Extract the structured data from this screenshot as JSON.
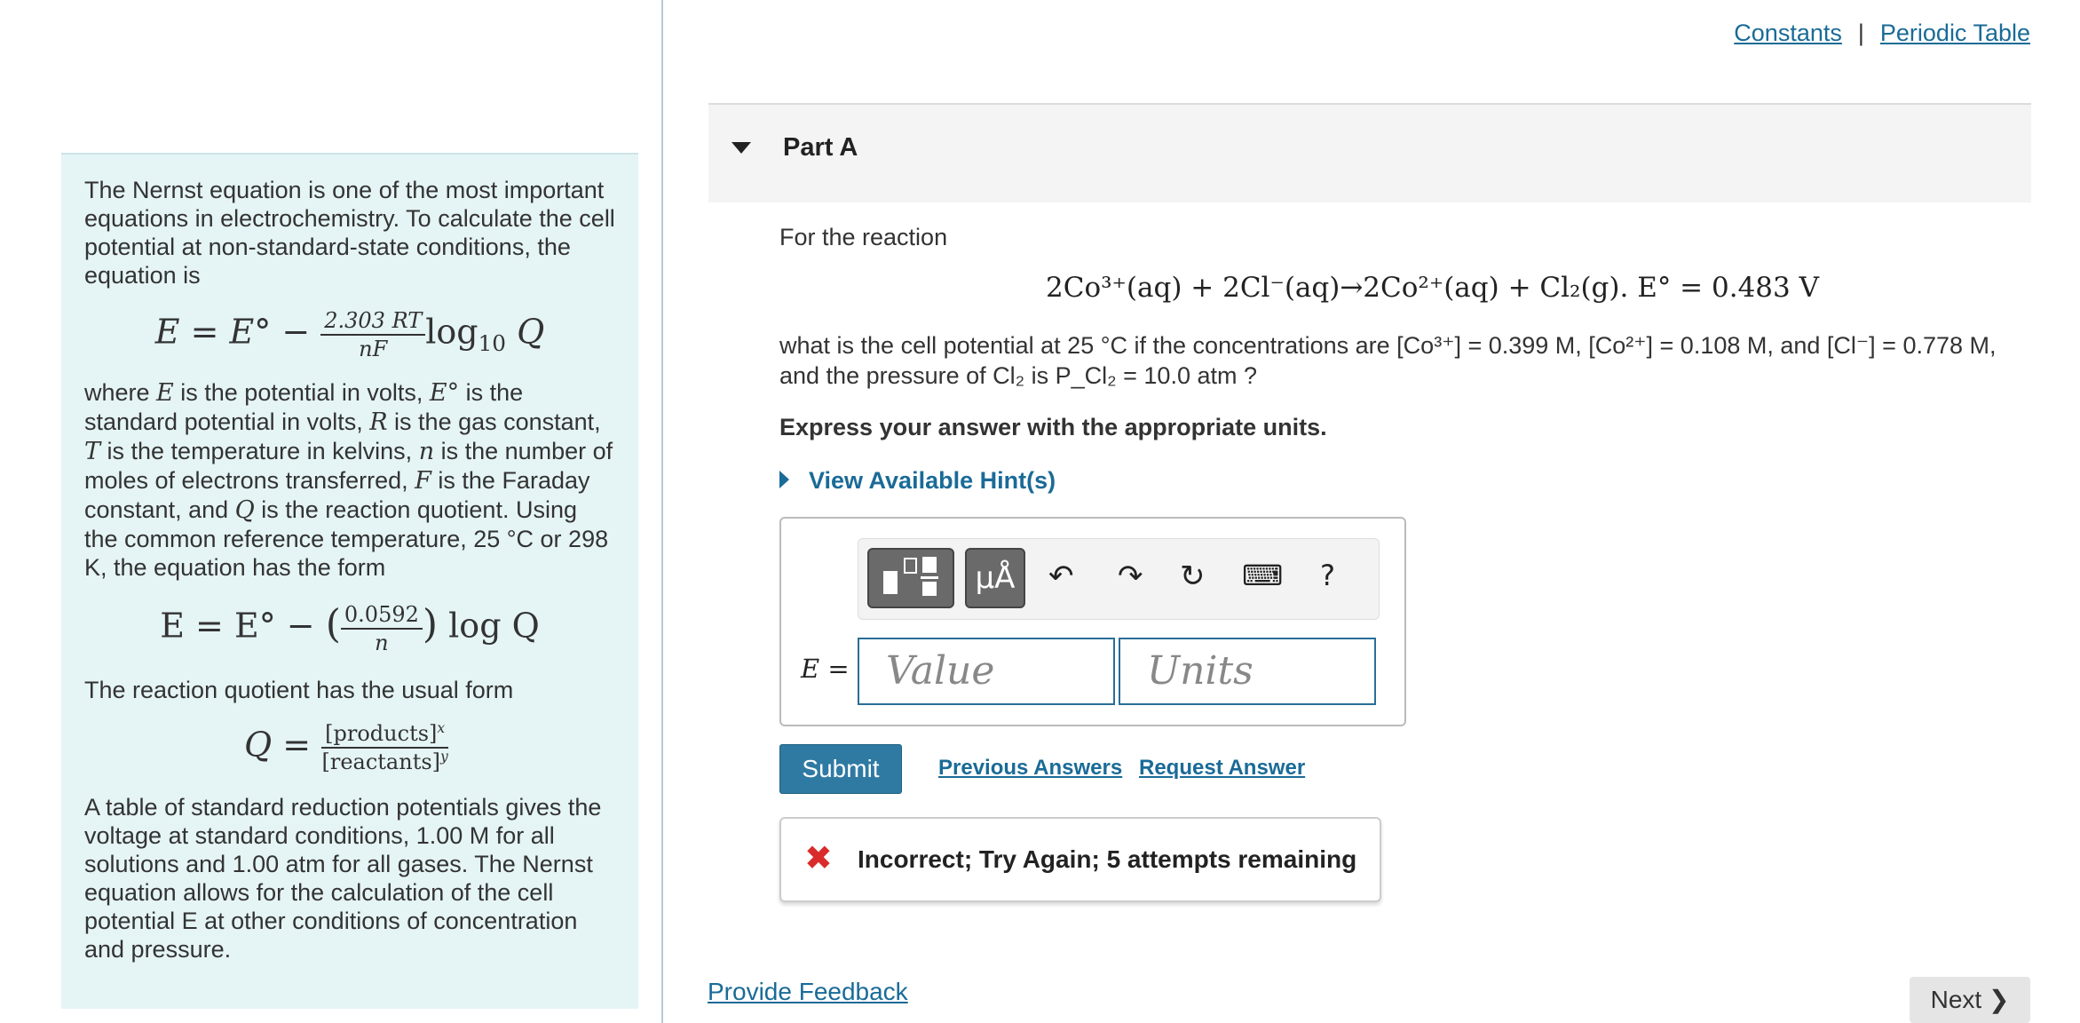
{
  "top_links": {
    "constants": "Constants",
    "separator": "|",
    "periodic_table": "Periodic Table"
  },
  "intro": {
    "p1": "The Nernst equation is one of the most important equations in electrochemistry. To calculate the cell potential at non-standard-state conditions, the equation is",
    "eq1": {
      "lhs": "E = E° −",
      "num": "2.303 RT",
      "den": "nF",
      "rhs": "log",
      "sub": "10",
      "q": "Q"
    },
    "p2_parts": [
      "where ",
      "E",
      " is the potential in volts, ",
      "E°",
      " is the standard potential in volts, ",
      "R",
      " is the gas constant, ",
      "T",
      " is the temperature in kelvins, ",
      "n",
      " is the number of moles of electrons transferred, ",
      "F",
      " is the Faraday constant, and ",
      "Q",
      " is the reaction quotient. Using the common reference temperature, 25 °C or 298 K, the equation has the form"
    ],
    "eq2": {
      "lhs": "E = E° −",
      "num": "0.0592",
      "den": "n",
      "rhs": "log Q"
    },
    "p3": "The reaction quotient has the usual form",
    "eq3": {
      "lhs": "Q =",
      "num": "[products]",
      "num_exp": "x",
      "den": "[reactants]",
      "den_exp": "y"
    },
    "p4": "A table of standard reduction potentials gives the voltage at standard conditions, 1.00 M for all solutions and 1.00 atm for all gases. The Nernst equation allows for the calculation of the cell potential E at other conditions of concentration and pressure."
  },
  "part": {
    "title": "Part A"
  },
  "question": {
    "lead": "For the reaction",
    "reaction": "2Co³⁺(aq) + 2Cl⁻(aq)→2Co²⁺(aq) + Cl₂(g).   E° = 0.483 V",
    "condition": "what is the cell potential at 25 °C if the concentrations are [Co³⁺] = 0.399 M, [Co²⁺] = 0.108 M, and [Cl⁻] = 0.778 M, and the pressure of Cl₂ is P_Cl₂ = 10.0 atm ?",
    "instruction": "Express your answer with the appropriate units.",
    "hint_link": "View Available Hint(s)"
  },
  "answer": {
    "toolbar": {
      "units_symbol": "μÅ",
      "undo": "↶",
      "redo": "↷",
      "reset": "↻",
      "keyboard": "⌨",
      "help": "?"
    },
    "label": "E =",
    "value_placeholder": "Value",
    "units_placeholder": "Units"
  },
  "actions": {
    "submit": "Submit",
    "previous_answers": "Previous Answers",
    "request_answer": "Request Answer"
  },
  "feedback": {
    "icon": "✖",
    "text": "Incorrect; Try Again; 5 attempts remaining"
  },
  "footer": {
    "provide_feedback": "Provide Feedback",
    "next": "Next ❯"
  }
}
